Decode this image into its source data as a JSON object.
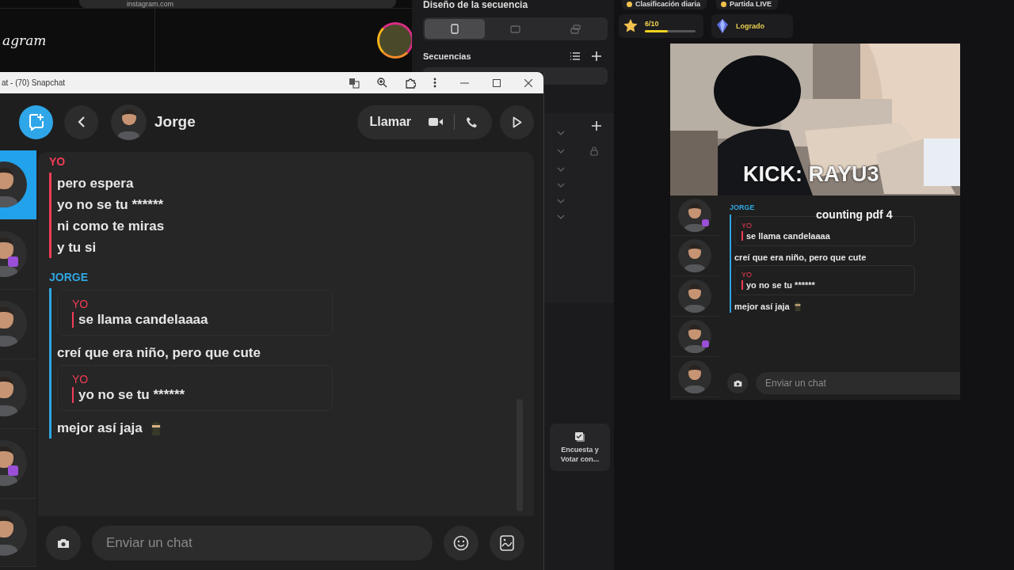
{
  "browser": {
    "url": "instagram.com",
    "logo": "agram"
  },
  "sequence_panel": {
    "title": "Diseño de la secuencia",
    "layouts": [
      {
        "kind": "portrait",
        "selected": true
      },
      {
        "kind": "landscape",
        "selected": false
      },
      {
        "kind": "dual",
        "selected": false
      }
    ],
    "section": "Secuencias",
    "rows": [
      {
        "locked": false
      },
      {
        "locked": true
      },
      {
        "locked": false
      },
      {
        "locked": false
      },
      {
        "locked": false
      },
      {
        "locked": false
      }
    ],
    "tile": "Encuesta y Votar con..."
  },
  "snapchat": {
    "title": "at - (70) Snapchat",
    "contact": "Jorge",
    "call_label": "Llamar",
    "contacts": [
      {
        "selected": true,
        "badge": false
      },
      {
        "selected": false,
        "badge": true
      },
      {
        "selected": false,
        "badge": false
      },
      {
        "selected": false,
        "badge": false
      },
      {
        "selected": false,
        "badge": true
      },
      {
        "selected": false,
        "badge": false
      }
    ],
    "groups": [
      {
        "sender": "YO",
        "kind": "me",
        "items": [
          {
            "kind": "text",
            "text": "pero espera",
            "emoji": false
          },
          {
            "kind": "text",
            "text": "yo no se tu ******",
            "emoji": false
          },
          {
            "kind": "text",
            "text": "ni como te miras",
            "emoji": false
          },
          {
            "kind": "text",
            "text": "y tu si",
            "emoji": false
          }
        ]
      },
      {
        "sender": "JORGE",
        "kind": "them",
        "items": [
          {
            "kind": "quote",
            "quote_sender": "YO",
            "text": "se llama candelaaaa"
          },
          {
            "kind": "text",
            "text": "creí que era niño, pero que cute",
            "emoji": false
          },
          {
            "kind": "quote",
            "quote_sender": "YO",
            "text": "yo no se tu ******"
          },
          {
            "kind": "text",
            "text": "mejor así jaja",
            "emoji": true
          }
        ]
      }
    ],
    "placeholder": "Enviar un chat"
  },
  "stream": {
    "badges": [
      "Clasificación diaria",
      "Partida LIVE"
    ],
    "goal": {
      "count": "6/10",
      "level": 0.45
    },
    "status": "Logrado",
    "caption": "KICK: RAYU3",
    "overlay": "counting pdf 4",
    "mini_chat": {
      "contacts": [
        {
          "badge": true
        },
        {
          "badge": false
        },
        {
          "badge": false
        },
        {
          "badge": true
        },
        {
          "badge": false
        }
      ],
      "groups": [
        {
          "sender": "JORGE",
          "kind": "them",
          "items": [
            {
              "kind": "quote",
              "quote_sender": "YO",
              "text": "se llama candelaaaa"
            },
            {
              "kind": "text",
              "text": "creí que era niño, pero que cute",
              "emoji": false
            },
            {
              "kind": "quote",
              "quote_sender": "YO",
              "text": "yo no se tu ******"
            },
            {
              "kind": "text",
              "text": "mejor así jaja",
              "emoji": true
            }
          ]
        }
      ],
      "placeholder": "Enviar un chat"
    }
  }
}
